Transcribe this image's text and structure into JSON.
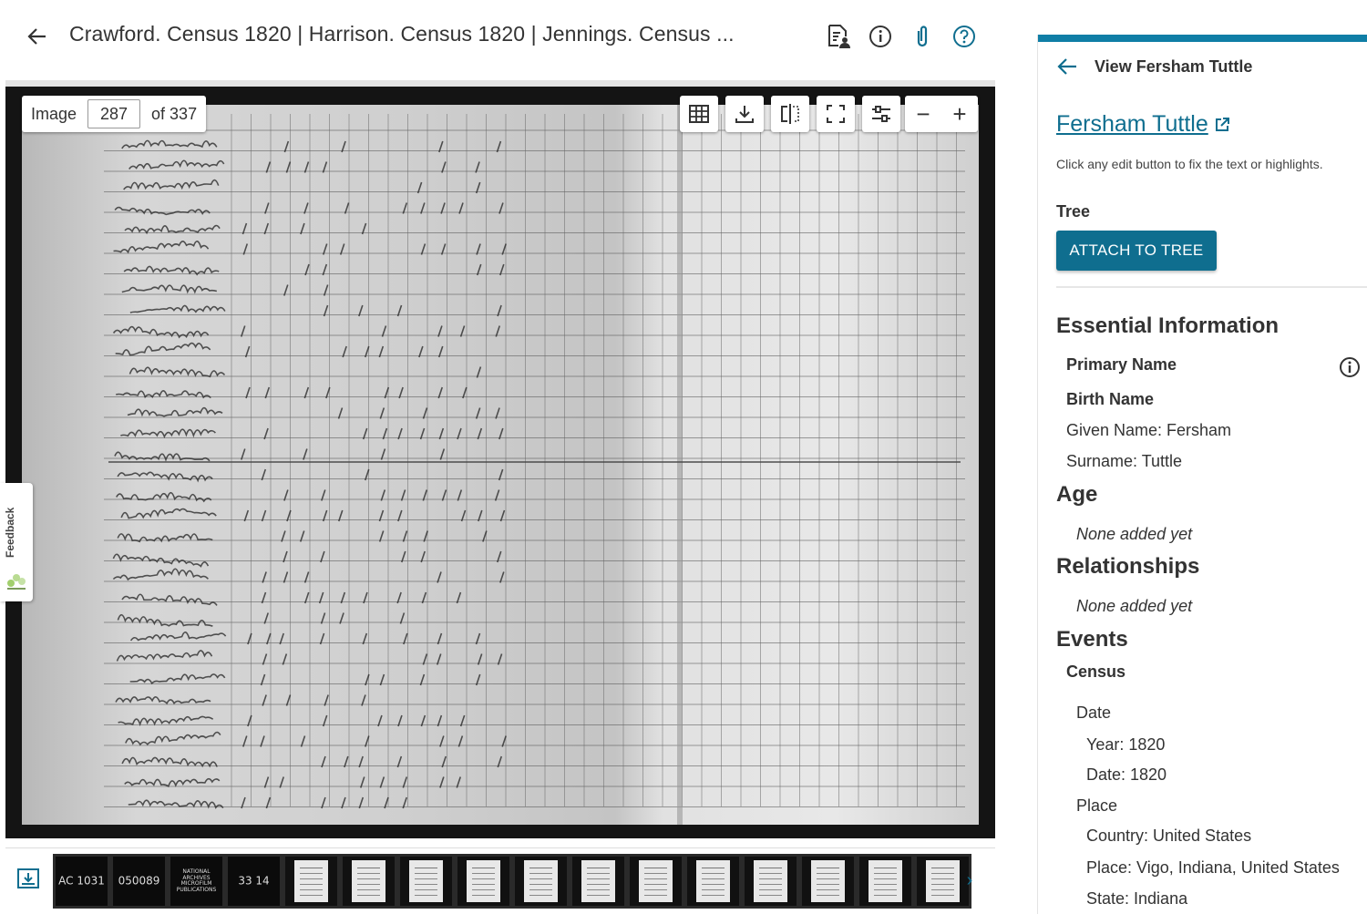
{
  "header": {
    "title": "Crawford. Census 1820 | Harrison. Census 1820 | Jennings. Census ...",
    "icons": [
      "document-person-icon",
      "info-icon",
      "attachment-icon",
      "help-icon"
    ]
  },
  "viewer": {
    "image_label": "Image",
    "image_number": "287",
    "image_total": "of 337",
    "zoom_out": "−",
    "zoom_in": "+",
    "tools": [
      "grid-icon",
      "download-icon",
      "compare-icon",
      "fullscreen-icon",
      "adjust-icon"
    ]
  },
  "feedback": {
    "label": "Feedback"
  },
  "filmstrip": {
    "thumbs": [
      {
        "label": "AC 1031",
        "kind": "dark"
      },
      {
        "label": "050089",
        "kind": "dark"
      },
      {
        "label": "NATIONAL ARCHIVES MICROFILM PUBLICATIONS",
        "kind": "dark"
      },
      {
        "label": "33 14",
        "kind": "dark"
      },
      {
        "label": "",
        "kind": "doc"
      },
      {
        "label": "",
        "kind": "doc"
      },
      {
        "label": "",
        "kind": "doc"
      },
      {
        "label": "",
        "kind": "doc"
      },
      {
        "label": "",
        "kind": "doc"
      },
      {
        "label": "",
        "kind": "doc"
      },
      {
        "label": "",
        "kind": "doc"
      },
      {
        "label": "",
        "kind": "doc"
      },
      {
        "label": "",
        "kind": "doc"
      },
      {
        "label": "",
        "kind": "doc"
      },
      {
        "label": "",
        "kind": "doc"
      },
      {
        "label": "",
        "kind": "doc"
      }
    ]
  },
  "panel": {
    "back_label": "View Fersham Tuttle",
    "person_name": "Fersham Tuttle",
    "hint": "Click any edit button to fix the text or highlights.",
    "tree_label": "Tree",
    "attach_button": "ATTACH TO TREE",
    "essential": {
      "heading": "Essential Information",
      "primary_name": "Primary Name",
      "birth_name": "Birth Name",
      "given_name": "Given Name: Fersham",
      "surname": "Surname: Tuttle"
    },
    "age": {
      "heading": "Age",
      "value": "None added yet"
    },
    "relationships": {
      "heading": "Relationships",
      "value": "None added yet"
    },
    "events": {
      "heading": "Events",
      "census": "Census",
      "date_label": "Date",
      "year": "Year: 1820",
      "date": "Date: 1820",
      "place_label": "Place",
      "country": "Country: United States",
      "place": "Place: Vigo, Indiana, United States",
      "state": "State: Indiana"
    }
  },
  "colors": {
    "accent": "#0f6e8f",
    "panel_bar": "#0f7ea6",
    "viewer_bg": "#141414"
  }
}
